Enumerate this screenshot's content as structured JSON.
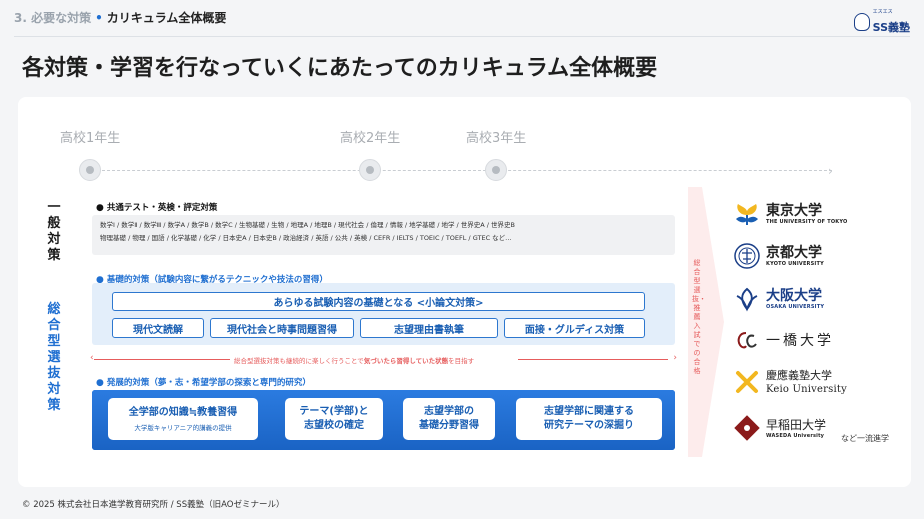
{
  "breadcrumb": {
    "section": "3. 必要な対策",
    "current": "カリキュラム全体概要"
  },
  "brand": {
    "name": "SS義塾",
    "tagline": "エスエス"
  },
  "page_title": "各対策・学習を行なっていくにあたってのカリキュラム全体概要",
  "years": [
    "高校1年生",
    "高校2年生",
    "高校3年生"
  ],
  "left_labels": {
    "general": "一般対策",
    "comprehensive": "総合型選抜対策"
  },
  "common": {
    "heading": "共通テスト・英検・評定対策",
    "subjects_line1": "数学Ⅰ / 数学Ⅱ / 数学Ⅲ / 数学A / 数学B / 数学C / 生物基礎 / 生物 / 地理A / 地理B / 現代社会 / 倫理 / 情報 / 地学基礎 / 地学 / 世界史A / 世界史B",
    "subjects_line2": "物理基礎 / 物理 / 国語 / 化学基礎 / 化学 / 日本史A / 日本史B / 政治経済 / 英語 / 公共 / 英検 / CEFR / IELTS / TOEIC / TOEFL / GTEC など…"
  },
  "basic": {
    "heading": "基礎的対策（試験内容に繋がるテクニックや技法の習得）",
    "top_pill": "あらゆる試験内容の基礎となる <小論文対策>",
    "pills": [
      "現代文読解",
      "現代社会と時事問題習得",
      "志望理由書執筆",
      "面接・グルディス対策"
    ]
  },
  "middle_note": {
    "prefix": "総合型選抜対策も継続的に楽しく行うことで",
    "emphasis": "気づいたら習得していた状態",
    "suffix": "を目指す"
  },
  "advanced": {
    "heading": "発展的対策（夢・志・希望学部の探索と専門的研究）",
    "pills": [
      {
        "line1": "全学部の知識≒教養習得",
        "line2": "",
        "sub": "大学版キャリアニア的講義の提供"
      },
      {
        "line1": "テーマ(学部)と",
        "line2": "志望校の確定",
        "sub": ""
      },
      {
        "line1": "志望学部の",
        "line2": "基礎分野習得",
        "sub": ""
      },
      {
        "line1": "志望学部に関連する",
        "line2": "研究テーマの深掘り",
        "sub": ""
      }
    ]
  },
  "arrow_text": "総合型選抜・推薦入試での合格",
  "universities": [
    {
      "jp": "東京大学",
      "en": "THE UNIVERSITY OF TOKYO",
      "color": "#1a1a1a"
    },
    {
      "jp": "京都大学",
      "en": "KYOTO UNIVERSITY",
      "color": "#1a1a1a"
    },
    {
      "jp": "大阪大学",
      "en": "OSAKA UNIVERSITY",
      "color": "#1b3f88"
    },
    {
      "jp": "一橋大学",
      "en": "",
      "color": "#1a1a1a"
    },
    {
      "jp": "慶應義塾大学",
      "en": "Keio University",
      "color": "#1a1a1a"
    },
    {
      "jp": "早稲田大学",
      "en": "WASEDA University",
      "color": "#1a1a1a"
    }
  ],
  "others_label": "など一流進学",
  "footer": "© 2025 株式会社日本進学教育研究所 / SS義塾（旧AOゼミナール）",
  "colors": {
    "accent": "#1f6fd1",
    "light_blue": "#e3eefa",
    "red_note": "#e65c5c"
  }
}
